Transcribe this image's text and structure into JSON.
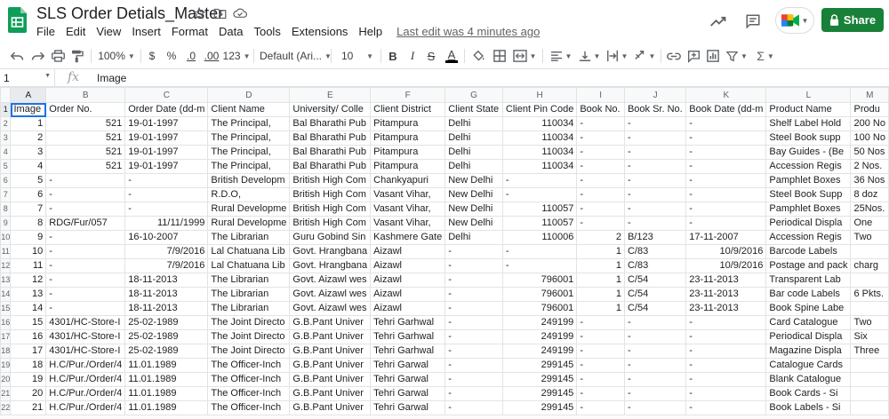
{
  "app": {
    "title": "SLS Order Detials_Master",
    "menu": [
      "File",
      "Edit",
      "View",
      "Insert",
      "Format",
      "Data",
      "Tools",
      "Extensions",
      "Help"
    ],
    "last_edit": "Last edit was 4 minutes ago",
    "share_label": "Share",
    "brand_color": "#188038"
  },
  "toolbar": {
    "zoom": "100%",
    "currency": "$",
    "percent": "%",
    "dec_decrease": ".0",
    "dec_increase": ".00",
    "format_more": "123",
    "font_family": "Default (Ari...",
    "font_size": "10",
    "bold": "B",
    "italic": "I",
    "strike": "S",
    "text_color": "A"
  },
  "formula_bar": {
    "cell_ref": "1",
    "fx": "fx",
    "content": "Image"
  },
  "sheet": {
    "columns": [
      "A",
      "B",
      "C",
      "D",
      "E",
      "F",
      "G",
      "H",
      "I",
      "J",
      "K",
      "L",
      "M"
    ],
    "rows": [
      [
        "Image",
        "Order No.",
        "Order Date (dd-m",
        "Client Name",
        "University/ Colle",
        "Client District",
        "Client State",
        "Client Pin Code",
        "Book No.",
        "Book Sr. No.",
        "Book Date (dd-m",
        "Product Name",
        "Produ"
      ],
      [
        "1",
        "521",
        "19-01-1997",
        "The Principal,",
        "Bal Bharathi Pub",
        "Pitampura",
        "Delhi",
        "110034",
        "-",
        "-",
        "-",
        "Shelf Label Hold",
        "200 No"
      ],
      [
        "2",
        "521",
        "19-01-1997",
        "The Principal,",
        "Bal Bharathi Pub",
        "Pitampura",
        "Delhi",
        "110034",
        "-",
        "-",
        "-",
        "Steel Book supp",
        "100 No"
      ],
      [
        "3",
        "521",
        "19-01-1997",
        "The Principal,",
        "Bal Bharathi Pub",
        "Pitampura",
        "Delhi",
        "110034",
        "-",
        "-",
        "-",
        "Bay Guides - (Be",
        "50 Nos"
      ],
      [
        "4",
        "521",
        "19-01-1997",
        "The Principal,",
        "Bal Bharathi Pub",
        "Pitampura",
        "Delhi",
        "110034",
        "-",
        "-",
        "-",
        "Accession Regis",
        "2 Nos."
      ],
      [
        "5",
        "-",
        "-",
        "British Developm",
        "British High Com",
        "Chankyapuri",
        "New Delhi",
        "-",
        "-",
        "-",
        "-",
        "Pamphlet Boxes",
        "36 Nos"
      ],
      [
        "6",
        "-",
        "-",
        "R.D.O,",
        "British High Com",
        "Vasant Vihar,",
        "New Delhi",
        "-",
        "-",
        "-",
        "-",
        "Steel Book Supp",
        "8 doz"
      ],
      [
        "7",
        "-",
        "-",
        "Rural Developme",
        "British High Com",
        "Vasant Vihar,",
        "New Delhi",
        "110057",
        "-",
        "-",
        "-",
        "Pamphlet Boxes",
        "25Nos."
      ],
      [
        "8",
        "RDG/Fur/057",
        "11/11/1999",
        "Rural Developme",
        "British High Com",
        "Vasant Vihar,",
        "New Delhi",
        "110057",
        "-",
        "-",
        "-",
        "Periodical Displa",
        "One"
      ],
      [
        "9",
        "-",
        "16-10-2007",
        "The Librarian",
        "Guru Gobind Sin",
        "Kashmere Gate",
        "Delhi",
        "110006",
        "2",
        "B/123",
        "17-11-2007",
        "Accession Regis",
        "Two"
      ],
      [
        "10",
        "-",
        "7/9/2016",
        "Lal Chatuana Lib",
        "Govt. Hrangbana",
        "Aizawl",
        "-",
        "-",
        "1",
        "C/83",
        "10/9/2016",
        "Barcode Labels",
        ""
      ],
      [
        "11",
        "-",
        "7/9/2016",
        "Lal Chatuana Lib",
        "Govt. Hrangbana",
        "Aizawl",
        "-",
        "-",
        "1",
        "C/83",
        "10/9/2016",
        "Postage and pack",
        "charg"
      ],
      [
        "12",
        "-",
        "18-11-2013",
        "The Librarian",
        "Govt. Aizawl wes",
        "Aizawl",
        "-",
        "796001",
        "1",
        "C/54",
        "23-11-2013",
        "Transparent Lab",
        ""
      ],
      [
        "13",
        "-",
        "18-11-2013",
        "The Librarian",
        "Govt. Aizawl wes",
        "Aizawl",
        "-",
        "796001",
        "1",
        "C/54",
        "23-11-2013",
        "Bar code Labels",
        "6 Pkts."
      ],
      [
        "14",
        "-",
        "18-11-2013",
        "The Librarian",
        "Govt. Aizawl wes",
        "Aizawl",
        "-",
        "796001",
        "1",
        "C/54",
        "23-11-2013",
        "Book Spine Labe",
        ""
      ],
      [
        "15",
        "4301/HC-Store-I",
        "25-02-1989",
        "The Joint Directo",
        "G.B.Pant Univer",
        "Tehri Garhwal",
        "-",
        "249199",
        "-",
        "-",
        "-",
        "Card Catalogue",
        "Two"
      ],
      [
        "16",
        "4301/HC-Store-I",
        "25-02-1989",
        "The Joint Directo",
        "G.B.Pant Univer",
        "Tehri Garhwal",
        "-",
        "249199",
        "-",
        "-",
        "-",
        "Periodical Displa",
        "Six"
      ],
      [
        "17",
        "4301/HC-Store-I",
        "25-02-1989",
        "The Joint Directo",
        "G.B.Pant Univer",
        "Tehri Garhwal",
        "-",
        "249199",
        "-",
        "-",
        "-",
        "Magazine Displa",
        "Three"
      ],
      [
        "18",
        "H.C/Pur./Order/4",
        "11.01.1989",
        "The Officer-Inch",
        "G.B.Pant Univer",
        "Tehri Garwal",
        "-",
        "299145",
        "-",
        "-",
        "-",
        "Catalogue Cards",
        ""
      ],
      [
        "19",
        "H.C/Pur./Order/4",
        "11.01.1989",
        "The Officer-Inch",
        "G.B.Pant Univer",
        "Tehri Garwal",
        "-",
        "299145",
        "-",
        "-",
        "-",
        "Blank Catalogue",
        ""
      ],
      [
        "20",
        "H.C/Pur./Order/4",
        "11.01.1989",
        "The Officer-Inch",
        "G.B.Pant Univer",
        "Tehri Garwal",
        "-",
        "299145",
        "-",
        "-",
        "-",
        "Book Cards - Si",
        ""
      ],
      [
        "21",
        "H.C/Pur./Order/4",
        "11.01.1989",
        "The Officer-Inch",
        "G.B.Pant Univer",
        "Tehri Garwal",
        "-",
        "299145",
        "-",
        "-",
        "-",
        "Book Labels - Si",
        ""
      ]
    ]
  }
}
